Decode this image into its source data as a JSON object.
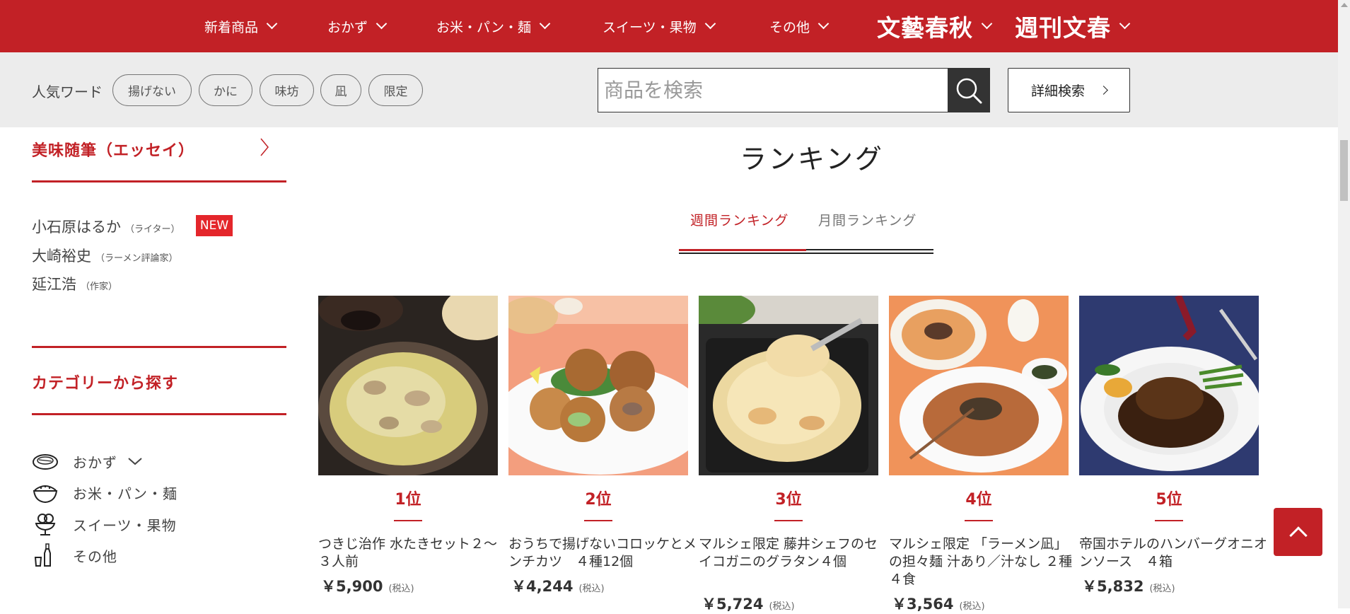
{
  "topnav": {
    "items": [
      {
        "label": "新着商品"
      },
      {
        "label": "おかず"
      },
      {
        "label": "お米・パン・麺"
      },
      {
        "label": "スイーツ・果物"
      },
      {
        "label": "その他"
      },
      {
        "label": "文藝春秋"
      },
      {
        "label": "週刊文春"
      }
    ],
    "bg_color": "#c22126"
  },
  "search": {
    "popular_label": "人気ワード",
    "popular_words": [
      "揚げない",
      "かに",
      "味坊",
      "凪",
      "限定"
    ],
    "placeholder": "商品を検索",
    "advanced_label": "詳細検索"
  },
  "sidebar": {
    "essay_title": "美味随筆（エッセイ）",
    "writers": [
      {
        "name": "小石原はるか",
        "role": "（ライター）",
        "badge": "NEW"
      },
      {
        "name": "大崎裕史",
        "role": "（ラーメン評論家）"
      },
      {
        "name": "延江浩",
        "role": "（作家）"
      }
    ],
    "category_title": "カテゴリーから探す",
    "categories": [
      {
        "label": "おかず",
        "icon": "dish-icon"
      },
      {
        "label": "お米・パン・麺",
        "icon": "rice-bowl-icon"
      },
      {
        "label": "スイーツ・果物",
        "icon": "parfait-icon"
      },
      {
        "label": "その他",
        "icon": "bottle-glass-icon"
      }
    ]
  },
  "ranking": {
    "title": "ランキング",
    "tabs": [
      "週間ランキング",
      "月間ランキング"
    ],
    "active_tab": "週間ランキング",
    "products": [
      {
        "rank": "1位",
        "name": "つきじ治作 水たきセット２～３人前",
        "price": "￥5,900",
        "tax": "(税込)"
      },
      {
        "rank": "2位",
        "name": "おうちで揚げないコロッケとメンチカツ　４種12個",
        "price": "￥4,244",
        "tax": "(税込)"
      },
      {
        "rank": "3位",
        "name": "マルシェ限定 藤井シェフのセイコガニのグラタン４個",
        "price": "￥5,724",
        "tax": "(税込)"
      },
      {
        "rank": "4位",
        "name": "マルシェ限定 「ラーメン凪」の担々麺 汁あり／汁なし ２種４食",
        "price": "￥3,564",
        "tax": "(税込)"
      },
      {
        "rank": "5位",
        "name": "帝国ホテルのハンバーグオニオンソース　４箱",
        "price": "￥5,832",
        "tax": "(税込)"
      }
    ]
  },
  "accent_color": "#c22126"
}
